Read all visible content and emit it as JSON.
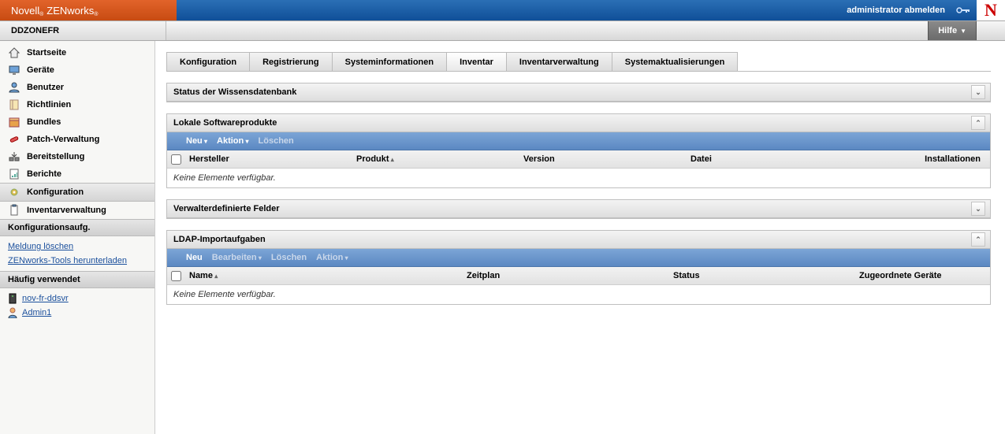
{
  "header": {
    "brand1": "Novell",
    "brand2": "ZENworks",
    "logout": "administrator abmelden"
  },
  "subheader": {
    "crumb": "DDZONEFR",
    "help": "Hilfe"
  },
  "sidebar": {
    "nav": [
      {
        "id": "home",
        "label": "Startseite"
      },
      {
        "id": "devices",
        "label": "Geräte"
      },
      {
        "id": "users",
        "label": "Benutzer"
      },
      {
        "id": "policies",
        "label": "Richtlinien"
      },
      {
        "id": "bundles",
        "label": "Bundles"
      },
      {
        "id": "patch",
        "label": "Patch-Verwaltung"
      },
      {
        "id": "deploy",
        "label": "Bereitstellung"
      },
      {
        "id": "reports",
        "label": "Berichte"
      },
      {
        "id": "config",
        "label": "Konfiguration"
      },
      {
        "id": "asset",
        "label": "Inventarverwaltung"
      }
    ],
    "tasks_hdr": "Konfigurationsaufg.",
    "tasks": [
      "Meldung löschen",
      "ZENworks-Tools herunterladen"
    ],
    "recent_hdr": "Häufig verwendet",
    "recent": [
      {
        "icon": "server",
        "label": "nov-fr-ddsvr"
      },
      {
        "icon": "user",
        "label": "Admin1"
      }
    ]
  },
  "tabs": [
    "Konfiguration",
    "Registrierung",
    "Systeminformationen",
    "Inventar",
    "Inventarverwaltung",
    "Systemaktualisierungen"
  ],
  "active_tab": 3,
  "panels": {
    "kb": {
      "title": "Status der Wissensdatenbank"
    },
    "local": {
      "title": "Lokale Softwareprodukte",
      "toolbar": {
        "neu": "Neu",
        "aktion": "Aktion",
        "del": "Löschen"
      },
      "cols": [
        "Hersteller",
        "Produkt",
        "Version",
        "Datei",
        "Installationen"
      ],
      "empty": "Keine Elemente verfügbar."
    },
    "admindef": {
      "title": "Verwalterdefinierte Felder"
    },
    "ldap": {
      "title": "LDAP-Importaufgaben",
      "toolbar": {
        "neu": "Neu",
        "edit": "Bearbeiten",
        "del": "Löschen",
        "aktion": "Aktion"
      },
      "cols": [
        "Name",
        "Zeitplan",
        "Status",
        "Zugeordnete Geräte"
      ],
      "empty": "Keine Elemente verfügbar."
    }
  }
}
